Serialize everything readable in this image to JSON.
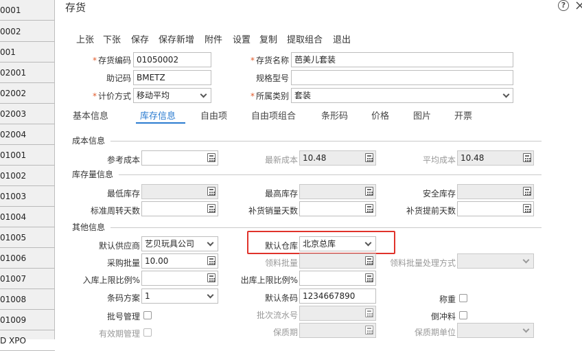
{
  "left_list": [
    "0001",
    "0002",
    "001",
    "02001",
    "02002",
    "02003",
    "02004",
    "01001",
    "01002",
    "01003",
    "01004",
    "01005",
    "01006",
    "01007",
    "01008",
    "01009",
    "D XPO"
  ],
  "dialog": {
    "title": "存货",
    "help_icon": "question-circle-icon",
    "close_icon": "close-icon"
  },
  "toolbar": [
    "上张",
    "下张",
    "保存",
    "保存新增",
    "附件",
    "设置",
    "复制",
    "提取组合",
    "退出"
  ],
  "header": {
    "code_label": "存货编码",
    "code_value": "01050002",
    "name_label": "存货名称",
    "name_value": "芭美儿套装",
    "mnemonic_label": "助记码",
    "mnemonic_value": "BMETZ",
    "spec_label": "规格型号",
    "spec_value": "",
    "pricing_label": "计价方式",
    "pricing_value": "移动平均",
    "category_label": "所属类别",
    "category_value": "套装"
  },
  "tabs": [
    "基本信息",
    "库存信息",
    "自由项",
    "自由项组合",
    "条形码",
    "价格",
    "图片",
    "开票"
  ],
  "active_tab": "库存信息",
  "sections": {
    "cost": "成本信息",
    "stock": "库存量信息",
    "other": "其他信息"
  },
  "cost": {
    "ref_cost_label": "参考成本",
    "ref_cost_value": "",
    "latest_cost_label": "最新成本",
    "latest_cost_value": "10.48",
    "avg_cost_label": "平均成本",
    "avg_cost_value": "10.48"
  },
  "stock": {
    "min_label": "最低库存",
    "max_label": "最高库存",
    "safe_label": "安全库存",
    "turnover_label": "标准周转天数",
    "replenish_sales_label": "补货销量天数",
    "replenish_lead_label": "补货提前天数"
  },
  "other": {
    "supplier_label": "默认供应商",
    "supplier_value": "艺贝玩具公司",
    "warehouse_label": "默认仓库",
    "warehouse_value": "北京总库",
    "purchase_batch_label": "采购批量",
    "purchase_batch_value": "10.00",
    "material_batch_label": "领料批量",
    "material_batch_mode_label": "领料批量处理方式",
    "in_limit_label": "入库上限比例%",
    "out_limit_label": "出库上限比例%",
    "barcode_scheme_label": "条码方案",
    "barcode_scheme_value": "1",
    "default_barcode_label": "默认条码",
    "default_barcode_value": "1234667890",
    "weigh_label": "称重",
    "batch_mgmt_label": "批号管理",
    "batch_serial_label": "批次流水号",
    "backflush_label": "倒冲料",
    "expiry_mgmt_label": "有效期管理",
    "shelf_life_label": "保质期",
    "shelf_unit_label": "保质期单位"
  },
  "highlight_color": "#e0322a",
  "accent_color": "#2a7bd0"
}
